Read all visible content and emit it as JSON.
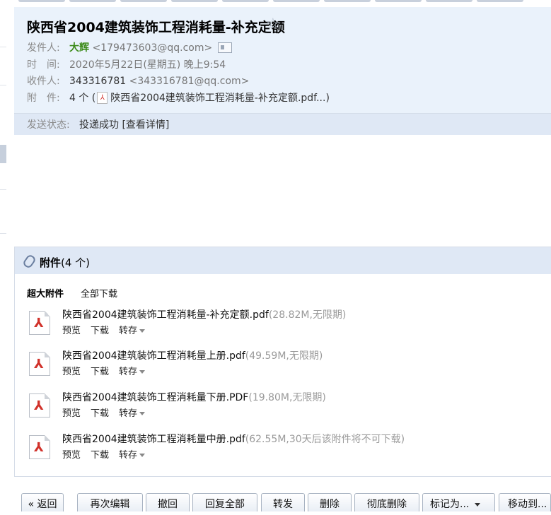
{
  "mail": {
    "subject": "陕西省2004建筑装饰工程消耗量-补充定额",
    "star_icon": "star-outline-icon",
    "sender_label": "发件人:",
    "sender_name": "大辉",
    "sender_email": "<179473603@qq.com>",
    "time_label": "时　间:",
    "time_value": "2020年5月22日(星期五) 晚上9:54",
    "recipient_label": "收件人:",
    "recipient_name": "343316781",
    "recipient_email": "<343316781@qq.com>",
    "attach_label": "附　件:",
    "attach_count_prefix": "4 个 (",
    "attach_first_file": "陕西省2004建筑装饰工程消耗量-补充定额.pdf...)",
    "status_label": "发送状态:",
    "status_value": "投递成功",
    "status_link": "[查看详情]"
  },
  "attachments": {
    "title": "附件",
    "count": "(4 个)",
    "big_label": "超大附件",
    "download_all": "全部下载",
    "preview_label": "预览",
    "download_label": "下载",
    "transfer_label": "转存",
    "files": [
      {
        "name": "陕西省2004建筑装饰工程消耗量-补充定额.pdf",
        "meta": "(28.82M,无限期)"
      },
      {
        "name": "陕西省2004建筑装饰工程消耗量上册.pdf",
        "meta": "(49.59M,无限期)"
      },
      {
        "name": "陕西省2004建筑装饰工程消耗量下册.PDF",
        "meta": "(19.80M,无限期)"
      },
      {
        "name": "陕西省2004建筑装饰工程消耗量中册.pdf",
        "meta": "(62.55M,30天后该附件将不可下载)"
      }
    ]
  },
  "toolbar": {
    "back": "« 返回",
    "edit_again": "再次编辑",
    "recall": "撤回",
    "reply_all": "回复全部",
    "forward": "转发",
    "delete": "删除",
    "delete_permanent": "彻底删除",
    "mark_as": "标记为...",
    "move_to": "移动到..."
  },
  "colors": {
    "header_bg": "#eaf2fb",
    "status_bg": "#dfe8f5",
    "sender_name": "#3b8a17",
    "pdf_red": "#d1312a"
  }
}
